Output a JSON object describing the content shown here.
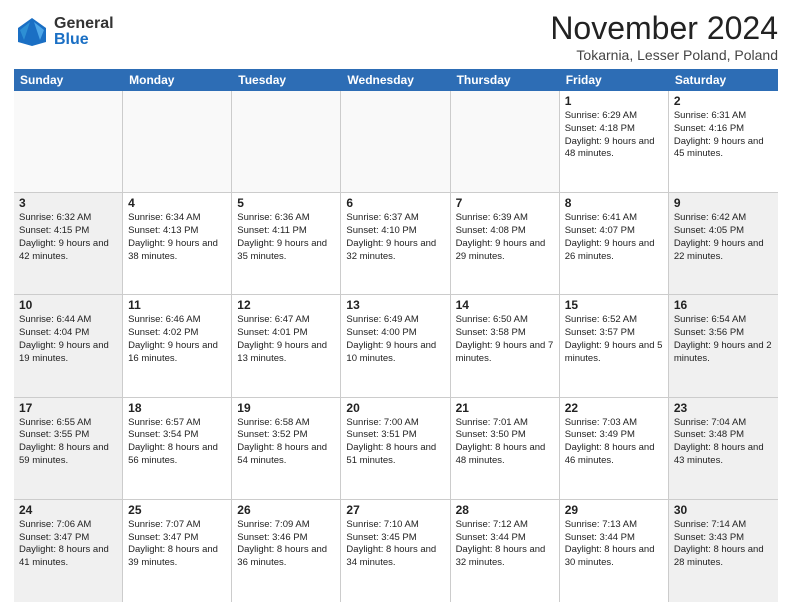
{
  "logo": {
    "general": "General",
    "blue": "Blue"
  },
  "header": {
    "month": "November 2024",
    "location": "Tokarnia, Lesser Poland, Poland"
  },
  "weekdays": [
    "Sunday",
    "Monday",
    "Tuesday",
    "Wednesday",
    "Thursday",
    "Friday",
    "Saturday"
  ],
  "weeks": [
    [
      {
        "day": "",
        "info": "",
        "shaded": true
      },
      {
        "day": "",
        "info": "",
        "shaded": true
      },
      {
        "day": "",
        "info": "",
        "shaded": true
      },
      {
        "day": "",
        "info": "",
        "shaded": true
      },
      {
        "day": "",
        "info": "",
        "shaded": true
      },
      {
        "day": "1",
        "info": "Sunrise: 6:29 AM\nSunset: 4:18 PM\nDaylight: 9 hours and 48 minutes.",
        "shaded": false
      },
      {
        "day": "2",
        "info": "Sunrise: 6:31 AM\nSunset: 4:16 PM\nDaylight: 9 hours and 45 minutes.",
        "shaded": false
      }
    ],
    [
      {
        "day": "3",
        "info": "Sunrise: 6:32 AM\nSunset: 4:15 PM\nDaylight: 9 hours and 42 minutes.",
        "shaded": true
      },
      {
        "day": "4",
        "info": "Sunrise: 6:34 AM\nSunset: 4:13 PM\nDaylight: 9 hours and 38 minutes.",
        "shaded": false
      },
      {
        "day": "5",
        "info": "Sunrise: 6:36 AM\nSunset: 4:11 PM\nDaylight: 9 hours and 35 minutes.",
        "shaded": false
      },
      {
        "day": "6",
        "info": "Sunrise: 6:37 AM\nSunset: 4:10 PM\nDaylight: 9 hours and 32 minutes.",
        "shaded": false
      },
      {
        "day": "7",
        "info": "Sunrise: 6:39 AM\nSunset: 4:08 PM\nDaylight: 9 hours and 29 minutes.",
        "shaded": false
      },
      {
        "day": "8",
        "info": "Sunrise: 6:41 AM\nSunset: 4:07 PM\nDaylight: 9 hours and 26 minutes.",
        "shaded": false
      },
      {
        "day": "9",
        "info": "Sunrise: 6:42 AM\nSunset: 4:05 PM\nDaylight: 9 hours and 22 minutes.",
        "shaded": true
      }
    ],
    [
      {
        "day": "10",
        "info": "Sunrise: 6:44 AM\nSunset: 4:04 PM\nDaylight: 9 hours and 19 minutes.",
        "shaded": true
      },
      {
        "day": "11",
        "info": "Sunrise: 6:46 AM\nSunset: 4:02 PM\nDaylight: 9 hours and 16 minutes.",
        "shaded": false
      },
      {
        "day": "12",
        "info": "Sunrise: 6:47 AM\nSunset: 4:01 PM\nDaylight: 9 hours and 13 minutes.",
        "shaded": false
      },
      {
        "day": "13",
        "info": "Sunrise: 6:49 AM\nSunset: 4:00 PM\nDaylight: 9 hours and 10 minutes.",
        "shaded": false
      },
      {
        "day": "14",
        "info": "Sunrise: 6:50 AM\nSunset: 3:58 PM\nDaylight: 9 hours and 7 minutes.",
        "shaded": false
      },
      {
        "day": "15",
        "info": "Sunrise: 6:52 AM\nSunset: 3:57 PM\nDaylight: 9 hours and 5 minutes.",
        "shaded": false
      },
      {
        "day": "16",
        "info": "Sunrise: 6:54 AM\nSunset: 3:56 PM\nDaylight: 9 hours and 2 minutes.",
        "shaded": true
      }
    ],
    [
      {
        "day": "17",
        "info": "Sunrise: 6:55 AM\nSunset: 3:55 PM\nDaylight: 8 hours and 59 minutes.",
        "shaded": true
      },
      {
        "day": "18",
        "info": "Sunrise: 6:57 AM\nSunset: 3:54 PM\nDaylight: 8 hours and 56 minutes.",
        "shaded": false
      },
      {
        "day": "19",
        "info": "Sunrise: 6:58 AM\nSunset: 3:52 PM\nDaylight: 8 hours and 54 minutes.",
        "shaded": false
      },
      {
        "day": "20",
        "info": "Sunrise: 7:00 AM\nSunset: 3:51 PM\nDaylight: 8 hours and 51 minutes.",
        "shaded": false
      },
      {
        "day": "21",
        "info": "Sunrise: 7:01 AM\nSunset: 3:50 PM\nDaylight: 8 hours and 48 minutes.",
        "shaded": false
      },
      {
        "day": "22",
        "info": "Sunrise: 7:03 AM\nSunset: 3:49 PM\nDaylight: 8 hours and 46 minutes.",
        "shaded": false
      },
      {
        "day": "23",
        "info": "Sunrise: 7:04 AM\nSunset: 3:48 PM\nDaylight: 8 hours and 43 minutes.",
        "shaded": true
      }
    ],
    [
      {
        "day": "24",
        "info": "Sunrise: 7:06 AM\nSunset: 3:47 PM\nDaylight: 8 hours and 41 minutes.",
        "shaded": true
      },
      {
        "day": "25",
        "info": "Sunrise: 7:07 AM\nSunset: 3:47 PM\nDaylight: 8 hours and 39 minutes.",
        "shaded": false
      },
      {
        "day": "26",
        "info": "Sunrise: 7:09 AM\nSunset: 3:46 PM\nDaylight: 8 hours and 36 minutes.",
        "shaded": false
      },
      {
        "day": "27",
        "info": "Sunrise: 7:10 AM\nSunset: 3:45 PM\nDaylight: 8 hours and 34 minutes.",
        "shaded": false
      },
      {
        "day": "28",
        "info": "Sunrise: 7:12 AM\nSunset: 3:44 PM\nDaylight: 8 hours and 32 minutes.",
        "shaded": false
      },
      {
        "day": "29",
        "info": "Sunrise: 7:13 AM\nSunset: 3:44 PM\nDaylight: 8 hours and 30 minutes.",
        "shaded": false
      },
      {
        "day": "30",
        "info": "Sunrise: 7:14 AM\nSunset: 3:43 PM\nDaylight: 8 hours and 28 minutes.",
        "shaded": true
      }
    ]
  ]
}
